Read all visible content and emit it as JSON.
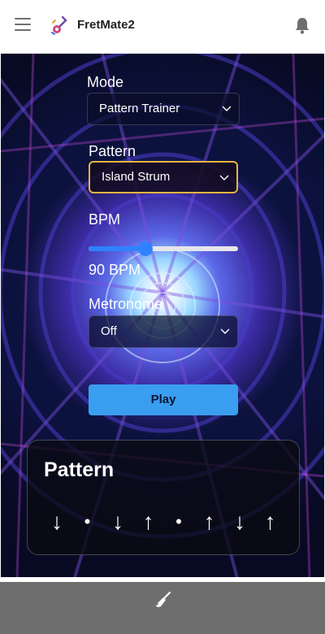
{
  "app": {
    "title": "FretMate2"
  },
  "icons": {
    "menu": "menu-icon",
    "logo": "guitar-logo",
    "notifications": "bell-icon",
    "clear": "broom-icon",
    "dropdown": "chevron-down-icon"
  },
  "controls": {
    "mode": {
      "label": "Mode",
      "value": "Pattern Trainer"
    },
    "pattern": {
      "label": "Pattern",
      "value": "Island Strum"
    },
    "bpm": {
      "label": "BPM",
      "readout": "90 BPM",
      "slider_fraction": 0.38
    },
    "metronome": {
      "label": "Metronome",
      "value": "Off"
    },
    "play_label": "Play"
  },
  "pattern_card": {
    "title": "Pattern",
    "strokes": [
      "↓",
      "•",
      "↓",
      "↑",
      "•",
      "↑",
      "↓",
      "↑"
    ]
  },
  "colors": {
    "accent": "#3a9ef0",
    "slider": "#2f82ff",
    "focus": "#e7b540",
    "bottom_bar": "#6e6e6e"
  }
}
